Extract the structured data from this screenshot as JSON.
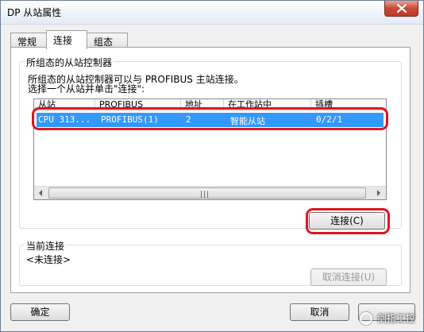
{
  "window": {
    "title": "DP 从站属性"
  },
  "tabs": [
    {
      "label": "常规"
    },
    {
      "label": "连接"
    },
    {
      "label": "组态"
    }
  ],
  "group_controllers": {
    "label": "所组态的从站控制器",
    "desc_line1": "所组态的从站控制器可以与 PROFIBUS 主站连接。",
    "desc_line2": "选择一个从站并单击\"连接\":"
  },
  "table": {
    "columns": [
      "从站",
      "PROFIBUS",
      "地址",
      "在工作站中",
      "插槽"
    ],
    "rows": [
      {
        "slave": "CPU 313...",
        "profibus": "PROFIBUS(1)",
        "address": "2",
        "station": "智能从站",
        "slot": "0/2/1",
        "selected": true
      }
    ],
    "scroll_grip": "|||"
  },
  "connect_button": {
    "label": "连接(C)"
  },
  "group_current": {
    "label": "当前连接",
    "value": "<未连接>"
  },
  "disconnect_button": {
    "label": "取消连接(U)"
  },
  "ok_button": {
    "label": "确定"
  },
  "cancel_button": {
    "label": "取消"
  },
  "watermark": {
    "text": "剑指工控"
  },
  "colors": {
    "selection": "#3399ff",
    "highlight": "#e0141e",
    "close": "#c74a35"
  }
}
